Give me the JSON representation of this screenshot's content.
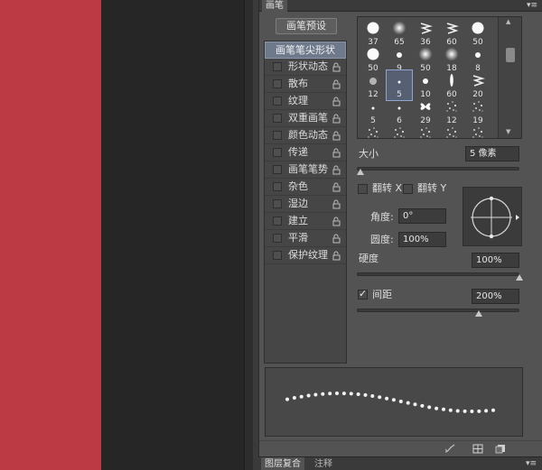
{
  "colors": {
    "canvas_red": "#bc3a43",
    "canvas_dark": "#262626"
  },
  "brush_panel": {
    "tab_label": "画笔",
    "menu_icon": "panel-menu-icon",
    "preset_button": "画笔预设",
    "options": [
      {
        "label": "画笔笔尖形状",
        "selected": true,
        "checkable": false
      },
      {
        "label": "形状动态",
        "checkable": true
      },
      {
        "label": "散布",
        "checkable": true
      },
      {
        "label": "纹理",
        "checkable": true
      },
      {
        "label": "双重画笔",
        "checkable": true
      },
      {
        "label": "颜色动态",
        "checkable": true
      },
      {
        "label": "传递",
        "checkable": true
      },
      {
        "label": "画笔笔势",
        "checkable": true
      },
      {
        "label": "杂色",
        "checkable": true
      },
      {
        "label": "湿边",
        "checkable": true
      },
      {
        "label": "建立",
        "checkable": true
      },
      {
        "label": "平滑",
        "checkable": true
      },
      {
        "label": "保护纹理",
        "checkable": true
      }
    ],
    "brush_tips": [
      {
        "size": "37",
        "kind": "hard"
      },
      {
        "size": "65",
        "kind": "soft"
      },
      {
        "size": "36",
        "kind": "leaf"
      },
      {
        "size": "60",
        "kind": "leaf"
      },
      {
        "size": "50",
        "kind": "hard"
      },
      {
        "size": "50",
        "kind": "hard"
      },
      {
        "size": "9",
        "kind": "hard-small"
      },
      {
        "size": "50",
        "kind": "soft"
      },
      {
        "size": "18",
        "kind": "soft"
      },
      {
        "size": "8",
        "kind": "hard-small"
      },
      {
        "size": "12",
        "kind": "soft-small"
      },
      {
        "size": "5",
        "kind": "hard-tiny",
        "selected": true
      },
      {
        "size": "10",
        "kind": "hard-small"
      },
      {
        "size": "60",
        "kind": "stroke"
      },
      {
        "size": "20",
        "kind": "leaf"
      },
      {
        "size": "5",
        "kind": "hard-tiny"
      },
      {
        "size": "6",
        "kind": "hard-tiny"
      },
      {
        "size": "29",
        "kind": "butterfly"
      },
      {
        "size": "12",
        "kind": "scatter"
      },
      {
        "size": "19",
        "kind": "scatter"
      },
      {
        "size": "",
        "kind": "scatter"
      },
      {
        "size": "",
        "kind": "scatter"
      },
      {
        "size": "",
        "kind": "scatter"
      },
      {
        "size": "",
        "kind": "scatter"
      },
      {
        "size": "",
        "kind": "scatter"
      }
    ],
    "size": {
      "label": "大小",
      "value": "5 像素",
      "fraction": 0.02
    },
    "flip_x": {
      "label": "翻转 X",
      "checked": false
    },
    "flip_y": {
      "label": "翻转 Y",
      "checked": false
    },
    "angle": {
      "label": "角度:",
      "value": "0°"
    },
    "roundness": {
      "label": "圆度:",
      "value": "100%"
    },
    "hardness": {
      "label": "硬度",
      "value": "100%",
      "fraction": 1.0
    },
    "spacing": {
      "label": "间距",
      "value": "200%",
      "checked": true,
      "fraction": 0.75
    },
    "bottom_icons": [
      "brush-toggle-icon",
      "grid-icon",
      "new-preset-icon"
    ]
  },
  "bottom_panel": {
    "tabs": [
      "图层复合",
      "注释"
    ],
    "menu_icon": "panel-menu-icon"
  }
}
